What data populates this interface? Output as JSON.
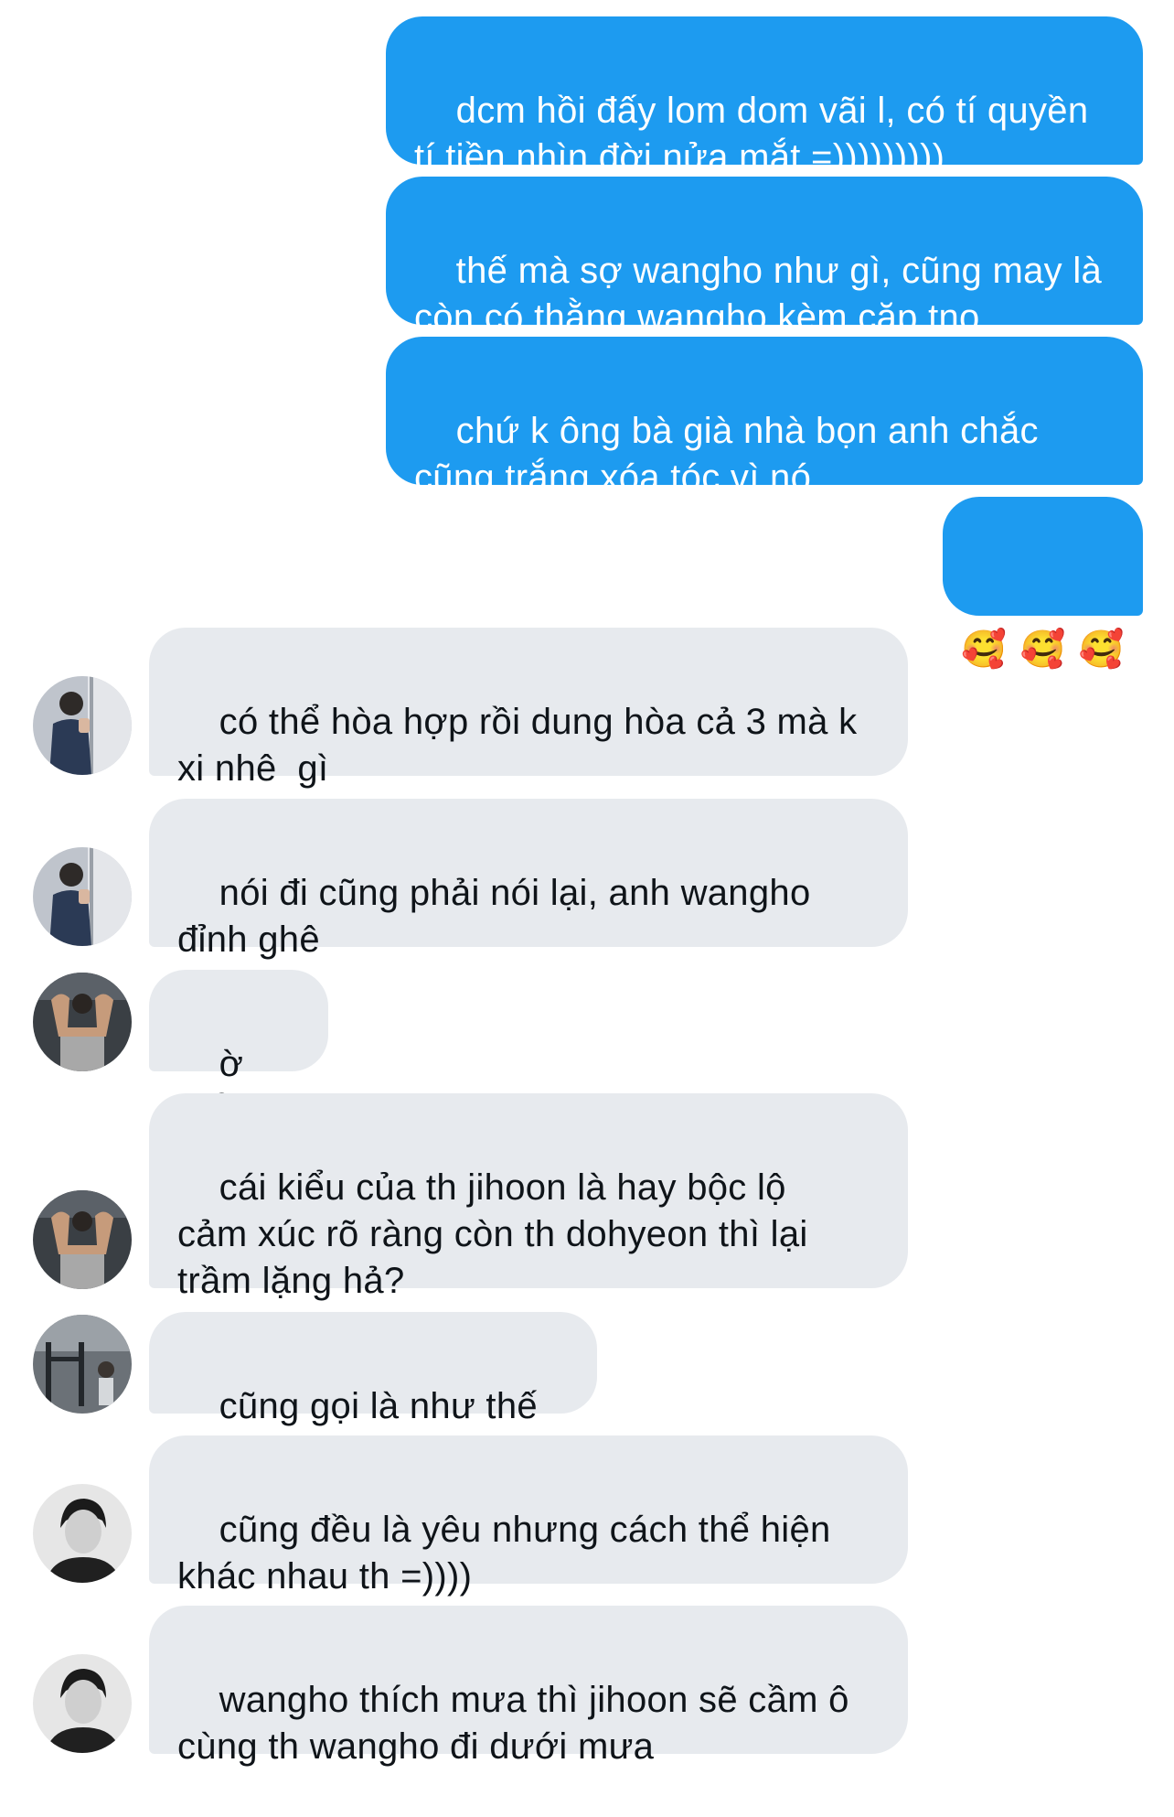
{
  "colors": {
    "outgoing_bubble": "#1d9bf0",
    "incoming_bubble": "#e7eaee",
    "outgoing_text": "#ffffff",
    "incoming_text": "#0f1419"
  },
  "messages": {
    "out_1": "dcm hồi đấy lom dom vãi l, có tí quyền\ntí tiền nhìn đời nửa mắt =)))))))))",
    "out_2": "thế mà sợ wangho như gì, cũng may là\ncòn có thằng wangho kèm cặp tno",
    "out_3": "chứ k ông bà già nhà bọn anh chắc\ncũng trắng xóa tóc vì nó",
    "out_4_emojis": [
      "🥰",
      "🥰",
      "🥰"
    ],
    "in_1": "có thể hòa hợp rồi dung hòa cả 3 mà k\nxi nhê  gì",
    "in_2": "nói đi cũng phải nói lại, anh wangho\nđỉnh ghê",
    "in_3": "ờ hiểu",
    "in_4": "cái kiểu của th jihoon là hay bộc lộ\ncảm xúc rõ ràng còn th dohyeon thì lại\ntrầm lặng hả?",
    "in_5": "cũng gọi là như thế đi",
    "in_6": "cũng đều là yêu nhưng cách thể hiện\nkhác nhau th =))))",
    "in_7": "wangho thích mưa thì jihoon sẽ cầm ô\ncùng th wangho đi dưới mưa"
  },
  "avatars": {
    "in_1": "profile-photo-person-at-door",
    "in_2": "profile-photo-person-at-door",
    "in_3": "profile-photo-shirtless-gym",
    "in_4": "profile-photo-shirtless-gym",
    "in_5": "profile-photo-gym-interior",
    "in_6": "profile-photo-young-man-bw",
    "in_7": "profile-photo-young-man-bw"
  }
}
